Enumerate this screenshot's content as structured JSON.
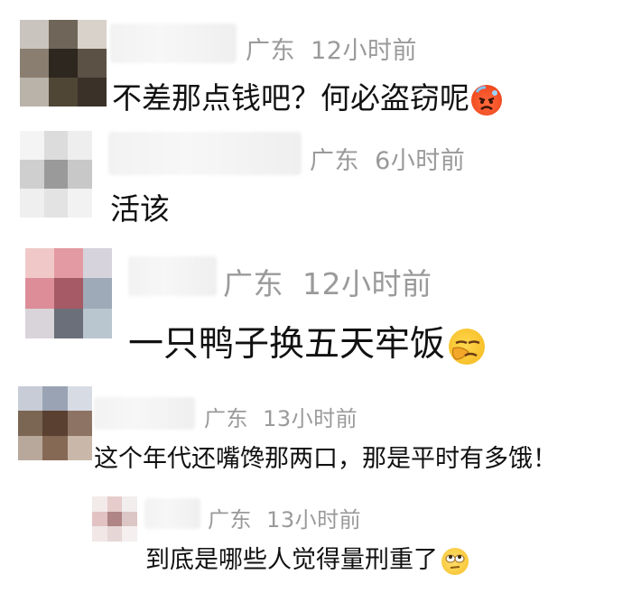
{
  "comments": [
    {
      "location": "广东",
      "time": "12小时前",
      "text": "不差那点钱吧？何必盗窃呢",
      "emoji": "angry-sweat-emoji",
      "avatar_colors": [
        "#c9c4bd",
        "#6f6558",
        "#d8d2ca",
        "#8a7e70",
        "#2e2720",
        "#5c5145",
        "#b9b3aa",
        "#504636",
        "#3a3128"
      ]
    },
    {
      "location": "广东",
      "time": "6小时前",
      "text": "活该",
      "emoji": "",
      "avatar_colors": [
        "#f4f4f4",
        "#dcdcdc",
        "#eeeeee",
        "#cfcfcf",
        "#9a9a9a",
        "#c8c8c8",
        "#efefef",
        "#e3e3e3",
        "#f2f2f2"
      ]
    },
    {
      "location": "广东",
      "time": "12小时前",
      "text": "一只鸭子换五天牢饭",
      "emoji": "face-palm-emoji",
      "avatar_colors": [
        "#f0c8c8",
        "#e49aa2",
        "#d6d3dc",
        "#dc8d98",
        "#a55a66",
        "#9eaab8",
        "#d9d3da",
        "#6b6f7a",
        "#b9c5cf"
      ]
    },
    {
      "location": "广东",
      "time": "13小时前",
      "text": "这个年代还嘴馋那两口，那是平时有多饿！",
      "emoji": "",
      "avatar_colors": [
        "#c7ccd7",
        "#9aa3b3",
        "#d7dbe4",
        "#7b6553",
        "#5a4030",
        "#8c7363",
        "#b8a89b",
        "#866955",
        "#c9b8aa"
      ]
    },
    {
      "location": "广东",
      "time": "13小时前",
      "text": "到底是哪些人觉得量刑重了",
      "emoji": "eye-roll-emoji",
      "avatar_colors": [
        "#f3eaea",
        "#e7cccc",
        "#f2eeee",
        "#e2c2c2",
        "#b08585",
        "#dcc6c6",
        "#f1e7e7",
        "#e6d6d6",
        "#f5efef"
      ]
    }
  ]
}
